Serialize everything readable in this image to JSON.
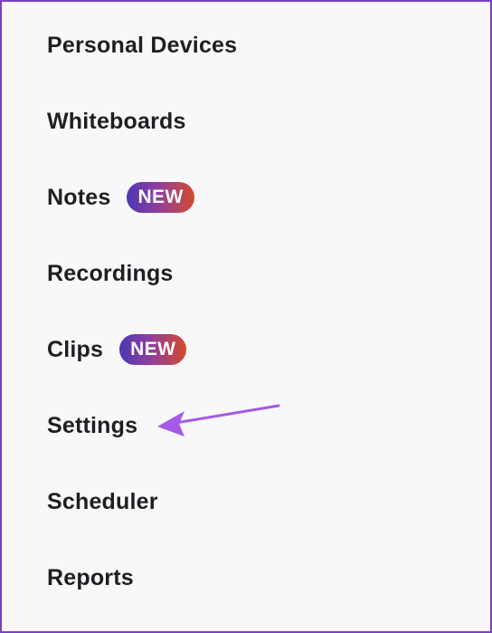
{
  "menu": {
    "items": [
      {
        "label": "Personal Devices",
        "badge": ""
      },
      {
        "label": "Whiteboards",
        "badge": ""
      },
      {
        "label": "Notes",
        "badge": "NEW"
      },
      {
        "label": "Recordings",
        "badge": ""
      },
      {
        "label": "Clips",
        "badge": "NEW"
      },
      {
        "label": "Settings",
        "badge": ""
      },
      {
        "label": "Scheduler",
        "badge": ""
      },
      {
        "label": "Reports",
        "badge": ""
      }
    ]
  },
  "annotation": {
    "arrow_icon": "arrow-pointer-icon",
    "target": "Settings",
    "color": "#a45ae6"
  },
  "colors": {
    "background": "#f8f7fa",
    "frame_border": "#7b3fc4",
    "text": "#1f1f22",
    "badge_gradient_start": "#4d37b3",
    "badge_gradient_end": "#d24b2c"
  }
}
